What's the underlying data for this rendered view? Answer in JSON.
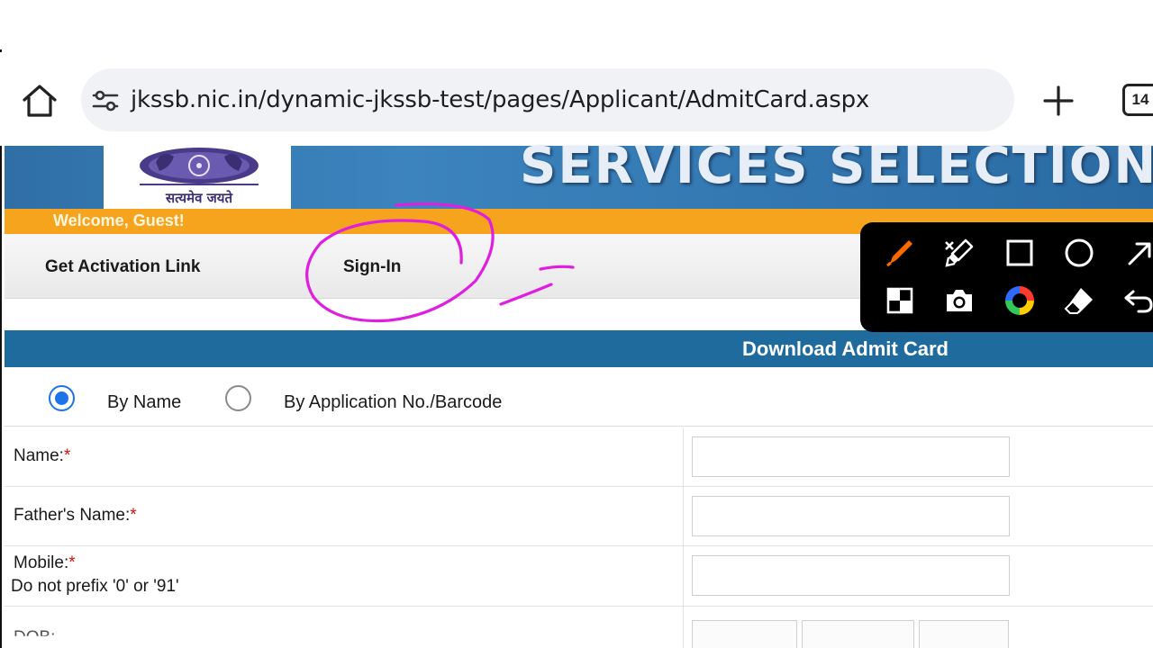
{
  "browser": {
    "url": "jkssb.nic.in/dynamic-jkssb-test/pages/Applicant/AdmitCard.aspx",
    "tab_count": "14",
    "icons": [
      "home-icon",
      "site-settings-icon",
      "plus-icon",
      "tab-switcher-icon"
    ]
  },
  "site": {
    "banner_title": "SERVICES SELECTION BO",
    "emblem_motto": "सत्यमेव जयते",
    "welcome": "Welcome, Guest!",
    "nav": [
      "Get Activation Link",
      "Sign-In"
    ]
  },
  "admit_card": {
    "title": "Download Admit Card",
    "search_options": [
      {
        "label": "By Name",
        "selected": true
      },
      {
        "label": "By Application No./Barcode",
        "selected": false
      }
    ],
    "fields": [
      {
        "label": "Name:",
        "required": "*",
        "value": ""
      },
      {
        "label": "Father's Name:",
        "required": "*",
        "value": ""
      },
      {
        "label": "Mobile:",
        "required": "*",
        "hint": "Do not prefix '0' or '91'",
        "value": ""
      }
    ],
    "dob_partial_label": "DOB:"
  },
  "annotation_toolbar": {
    "tools": [
      "pen-icon",
      "highlighter-icon",
      "rectangle-icon",
      "circle-icon",
      "arrow-icon",
      "mosaic-icon",
      "camera-icon",
      "color-wheel-icon",
      "eraser-icon",
      "undo-icon"
    ],
    "active_color": "#ff6a00",
    "scribble_color": "#e01ee0"
  },
  "colors": {
    "banner_blue": "#2f6fa6",
    "welcome_orange": "#f6a31e",
    "section_blue": "#1f6b9e",
    "radio_blue": "#1f73e8",
    "required_red": "#d31010"
  }
}
